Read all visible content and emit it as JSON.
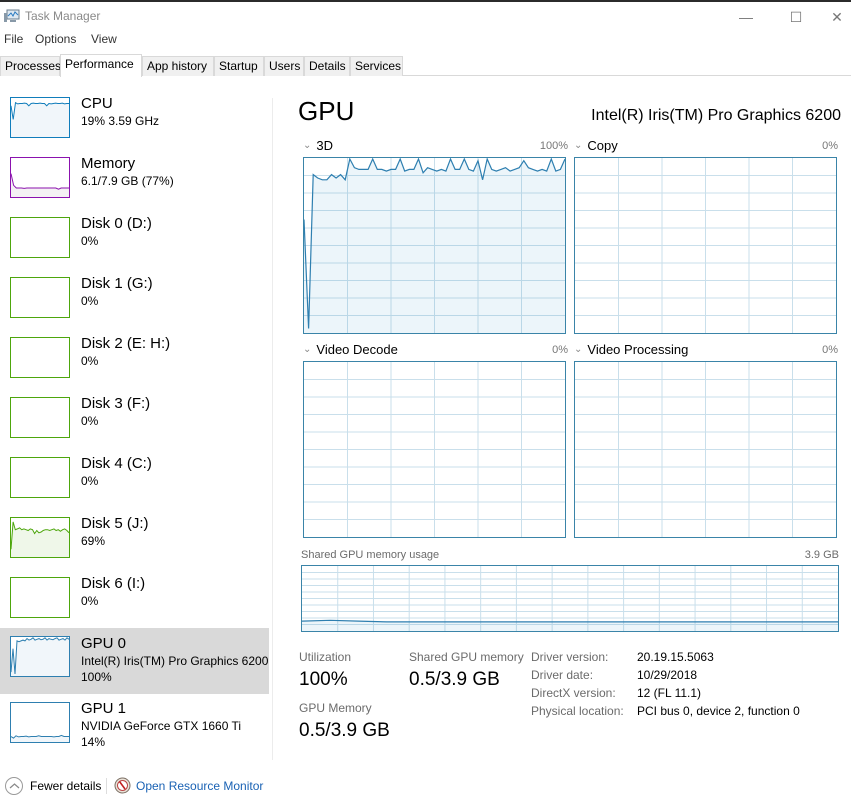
{
  "window": {
    "title": "Task Manager",
    "controls": {
      "minimize": "—",
      "maximize": "☐",
      "close": "✕"
    }
  },
  "menu": [
    "File",
    "Options",
    "View"
  ],
  "tabs": [
    {
      "label": "Processes",
      "active": false
    },
    {
      "label": "Performance",
      "active": true
    },
    {
      "label": "App history",
      "active": false
    },
    {
      "label": "Startup",
      "active": false
    },
    {
      "label": "Users",
      "active": false
    },
    {
      "label": "Details",
      "active": false
    },
    {
      "label": "Services",
      "active": false
    }
  ],
  "colors": {
    "cpu": "#117dbb",
    "memory": "#8b12ae",
    "disk": "#4da60c",
    "gpu": "#2e7fb0",
    "selected_bg": "#d9d9d9",
    "link": "#1a62b4"
  },
  "sidebar": [
    {
      "name": "CPU",
      "sub": "19%  3.59 GHz",
      "kind": "cpu",
      "series": [
        80,
        45,
        88,
        85,
        86,
        86,
        87,
        86,
        80,
        86,
        87,
        86,
        86,
        87,
        86,
        86,
        80,
        86,
        85,
        86,
        87,
        86,
        86,
        87,
        85,
        86,
        86
      ]
    },
    {
      "name": "Memory",
      "sub": "6.1/7.9 GB (77%)",
      "kind": "memory",
      "series": [
        60,
        30,
        23,
        23,
        23,
        22,
        23,
        23,
        23,
        23,
        23,
        23,
        23,
        23,
        23,
        23,
        23,
        23,
        20,
        23,
        23,
        23,
        23
      ]
    },
    {
      "name": "Disk 0 (D:)",
      "sub": "0%",
      "kind": "disk",
      "series": []
    },
    {
      "name": "Disk 1 (G:)",
      "sub": "0%",
      "kind": "disk",
      "series": []
    },
    {
      "name": "Disk 2 (E: H:)",
      "sub": "0%",
      "kind": "disk",
      "series": []
    },
    {
      "name": "Disk 3 (F:)",
      "sub": "0%",
      "kind": "disk",
      "series": []
    },
    {
      "name": "Disk 4 (C:)",
      "sub": "0%",
      "kind": "disk",
      "series": []
    },
    {
      "name": "Disk 5 (J:)",
      "sub": "69%",
      "kind": "disk",
      "series": [
        20,
        90,
        70,
        72,
        75,
        70,
        72,
        70,
        68,
        72,
        70,
        60,
        68,
        62,
        64,
        68,
        70,
        70,
        68,
        70,
        72,
        68,
        70,
        66,
        70,
        72,
        68,
        62
      ]
    },
    {
      "name": "Disk 6 (I:)",
      "sub": "0%",
      "kind": "disk",
      "series": []
    },
    {
      "name": "GPU 0",
      "sub": "Intel(R) Iris(TM) Pro Graphics 6200",
      "sub2": "100%",
      "kind": "gpu",
      "selected": true,
      "series": [
        10,
        70,
        5,
        90,
        88,
        90,
        92,
        90,
        96,
        92,
        94,
        98,
        92,
        94,
        96,
        93,
        94,
        98,
        92,
        96,
        94,
        93,
        96,
        98,
        92,
        94,
        96,
        92,
        98,
        94
      ]
    },
    {
      "name": "GPU 1",
      "sub": "NVIDIA GeForce GTX 1660 Ti",
      "sub2": "14%",
      "kind": "gpu",
      "series": [
        14,
        10,
        16,
        13,
        14,
        14,
        15,
        13,
        14,
        14,
        14,
        16,
        14,
        14,
        14,
        14,
        14,
        13,
        14,
        14,
        17,
        14,
        14,
        14
      ]
    }
  ],
  "main": {
    "title": "GPU",
    "device_name": "Intel(R) Iris(TM) Pro Graphics 6200",
    "graphs": [
      {
        "label": "3D",
        "max": "100%"
      },
      {
        "label": "Copy",
        "max": "0%"
      },
      {
        "label": "Video Decode",
        "max": "0%"
      },
      {
        "label": "Video Processing",
        "max": "0%"
      }
    ],
    "shared_memory": {
      "label": "Shared GPU memory usage",
      "max": "3.9 GB"
    },
    "stats": {
      "utilization_label": "Utilization",
      "utilization_value": "100%",
      "shared_mem_label": "Shared GPU memory",
      "shared_mem_value": "0.5/3.9 GB",
      "gpu_mem_label": "GPU Memory",
      "gpu_mem_value": "0.5/3.9 GB"
    },
    "info": [
      {
        "label": "Driver version:",
        "value": "20.19.15.5063"
      },
      {
        "label": "Driver date:",
        "value": "10/29/2018"
      },
      {
        "label": "DirectX version:",
        "value": "12 (FL 11.1)"
      },
      {
        "label": "Physical location:",
        "value": "PCI bus 0, device 2, function 0"
      }
    ]
  },
  "footer": {
    "fewer_details": "Fewer details",
    "resource_monitor": "Open Resource Monitor"
  },
  "chart_data": [
    {
      "type": "line",
      "title": "3D",
      "ylim": [
        0,
        100
      ],
      "ymax_label": "100%",
      "grid": true,
      "values": [
        65,
        2,
        91,
        89,
        88,
        88,
        91,
        89,
        91,
        88,
        100,
        95,
        94,
        94,
        94,
        100,
        94,
        94,
        93,
        94,
        94,
        100,
        93,
        94,
        94,
        100,
        92,
        95,
        94,
        93,
        94,
        93,
        100,
        94,
        94,
        100,
        94,
        93,
        99,
        88,
        100,
        94,
        93,
        94,
        95,
        93,
        94,
        95,
        99,
        95,
        94,
        93,
        94,
        93,
        100,
        93,
        94,
        100
      ]
    },
    {
      "type": "line",
      "title": "Copy",
      "ylim": [
        0,
        100
      ],
      "ymax_label": "0%",
      "grid": true,
      "values": []
    },
    {
      "type": "line",
      "title": "Video Decode",
      "ylim": [
        0,
        100
      ],
      "ymax_label": "0%",
      "grid": true,
      "values": []
    },
    {
      "type": "line",
      "title": "Video Processing",
      "ylim": [
        0,
        100
      ],
      "ymax_label": "0%",
      "grid": true,
      "values": []
    },
    {
      "type": "area",
      "title": "Shared GPU memory usage",
      "ylim": [
        0,
        3.9
      ],
      "ymax_label": "3.9 GB",
      "grid": true,
      "values": [
        0.55,
        0.6,
        0.55,
        0.5,
        0.5,
        0.5,
        0.5,
        0.5,
        0.5,
        0.5,
        0.5,
        0.5,
        0.5,
        0.5,
        0.5,
        0.5,
        0.5,
        0.5,
        0.5,
        0.5
      ]
    }
  ]
}
